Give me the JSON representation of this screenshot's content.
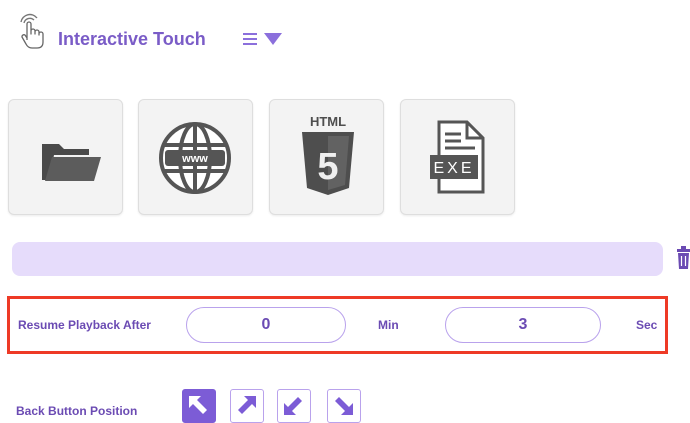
{
  "header": {
    "title": "Interactive Touch",
    "logo_icon": "touch-hand-icon",
    "menu_icon": "list-dropdown-icon"
  },
  "sources": [
    {
      "name": "folder",
      "icon": "folder-icon"
    },
    {
      "name": "web",
      "icon": "globe-www-icon",
      "icon_text": "www"
    },
    {
      "name": "html",
      "icon": "html5-icon",
      "icon_text": "HTML",
      "badge": "5"
    },
    {
      "name": "exe",
      "icon": "exe-file-icon",
      "icon_text": "EXE"
    }
  ],
  "path": {
    "value": "",
    "delete_icon": "trash-icon"
  },
  "resume": {
    "label": "Resume Playback After",
    "minutes": "0",
    "min_unit": "Min",
    "seconds": "3",
    "sec_unit": "Sec"
  },
  "back_button": {
    "label": "Back Button Position",
    "selected": "top-left",
    "positions": [
      "top-left",
      "top-right",
      "bottom-left",
      "bottom-right"
    ]
  },
  "colors": {
    "accent": "#7a5cc7",
    "selected": "#7c5cd6",
    "path_bar": "#e6dcfb",
    "highlight_border": "#ee3a26"
  }
}
